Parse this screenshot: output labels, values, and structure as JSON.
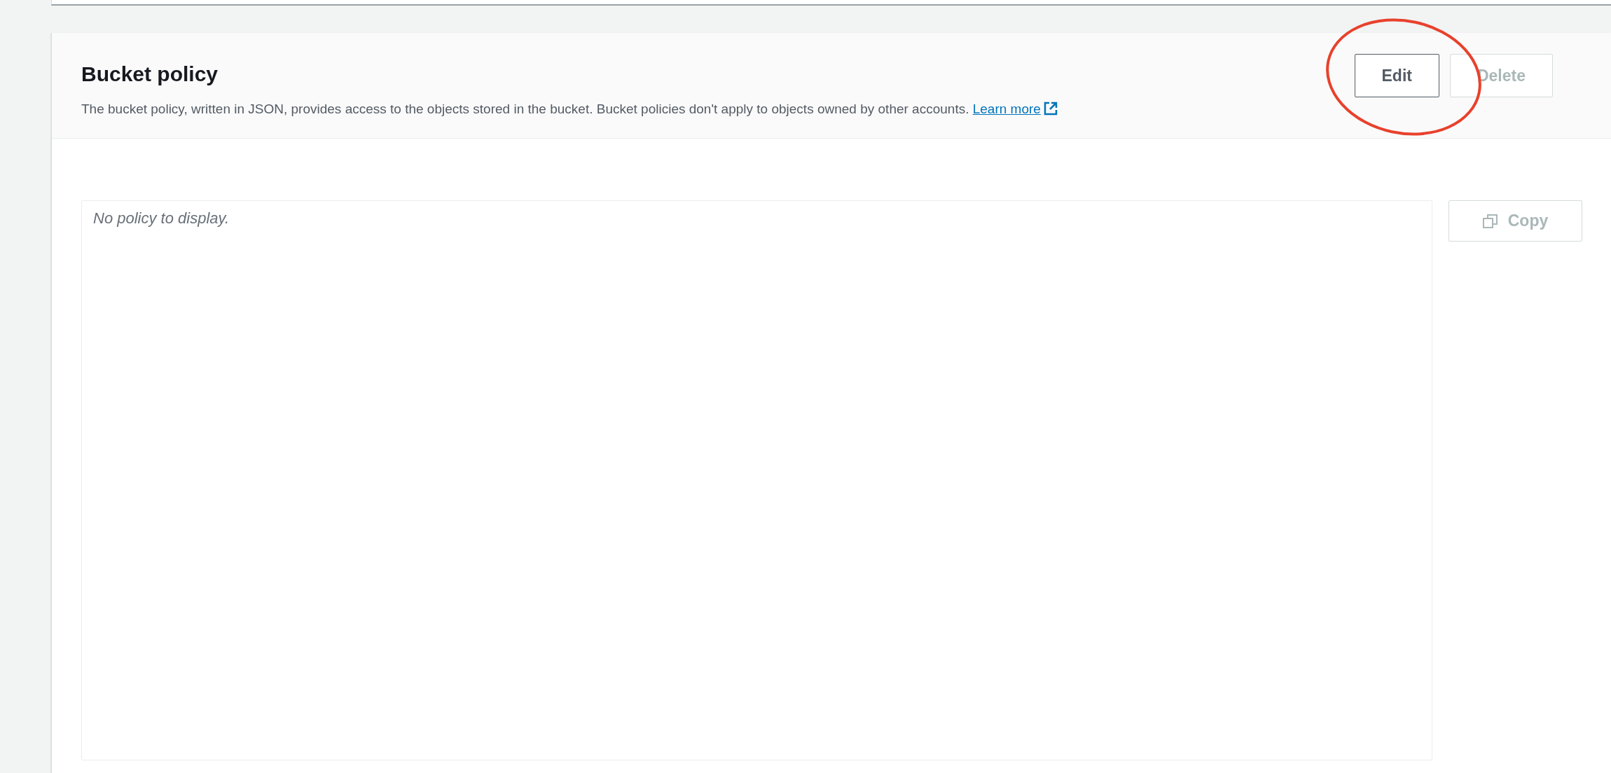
{
  "section": {
    "title": "Bucket policy",
    "description": "The bucket policy, written in JSON, provides access to the objects stored in the bucket. Bucket policies don't apply to objects owned by other accounts.",
    "link": "Learn more"
  },
  "buttons": [
    {
      "label": "Edit",
      "disabled": false
    },
    {
      "label": "Delete",
      "disabled": true
    }
  ],
  "policy": {
    "empty_text": "No policy to display."
  },
  "copy_button": {
    "label": "Copy",
    "disabled": true
  }
}
